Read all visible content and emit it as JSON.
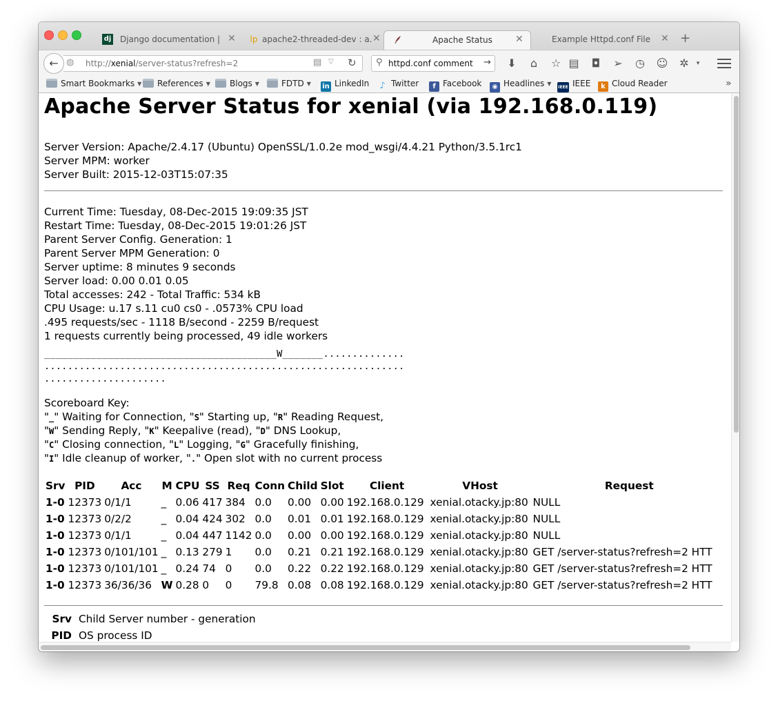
{
  "browser": {
    "tabs": [
      {
        "label": "Django documentation | ...",
        "icon": "dj",
        "active": false
      },
      {
        "label": "apache2-threaded-dev : a...",
        "icon": "lp",
        "active": false
      },
      {
        "label": "Apache Status",
        "icon": "apache-feather-icon",
        "active": true
      },
      {
        "label": "Example Httpd.conf File",
        "icon": "",
        "active": false
      }
    ],
    "url": {
      "prefix": "http://",
      "host": "xenial",
      "path": "/server-status?refresh=2"
    },
    "search": {
      "value": "httpd.conf comment"
    },
    "bookmarks": [
      {
        "label": "Smart Bookmarks",
        "type": "folder"
      },
      {
        "label": "References",
        "type": "folder"
      },
      {
        "label": "Blogs",
        "type": "folder"
      },
      {
        "label": "FDTD",
        "type": "folder"
      },
      {
        "label": "LinkedIn",
        "type": "link",
        "badge": "in",
        "color": "#0e76a8"
      },
      {
        "label": "Twitter",
        "type": "link",
        "color": "#55acee"
      },
      {
        "label": "Facebook",
        "type": "link",
        "badge": "f",
        "color": "#3b5998"
      },
      {
        "label": "Headlines",
        "type": "folder-feed",
        "color": "#3a5ba0"
      },
      {
        "label": "IEEE",
        "type": "link",
        "badge": "IEEE",
        "color": "#00285a"
      },
      {
        "label": "Cloud Reader",
        "type": "link",
        "badge": "k",
        "color": "#e07a10"
      }
    ]
  },
  "page": {
    "title": "Apache Server Status for xenial (via 192.168.0.119)",
    "server_info": [
      "Server Version: Apache/2.4.17 (Ubuntu) OpenSSL/1.0.2e mod_wsgi/4.4.21 Python/3.5.1rc1",
      "Server MPM: worker",
      "Server Built: 2015-12-03T15:07:35"
    ],
    "status_info": [
      "Current Time: Tuesday, 08-Dec-2015 19:09:35 JST",
      "Restart Time: Tuesday, 08-Dec-2015 19:01:26 JST",
      "Parent Server Config. Generation: 1",
      "Parent Server MPM Generation: 0",
      "Server uptime: 8 minutes 9 seconds",
      "Server load: 0.00 0.01 0.05",
      "Total accesses: 242 - Total Traffic: 534 kB",
      "CPU Usage: u.17 s.11 cu0 cs0 - .0573% CPU load",
      ".495 requests/sec - 1118 B/second - 2259 B/request",
      "1 requests currently being processed, 49 idle workers"
    ],
    "scoreboard": [
      "________________________________________W_______..............",
      "..............................................................",
      "....................."
    ],
    "scoreboard_key": {
      "title": "Scoreboard Key:",
      "lines": [
        [
          {
            "t": "\""
          },
          {
            "b": "_"
          },
          {
            "t": "\" Waiting for Connection, \""
          },
          {
            "b": "S"
          },
          {
            "t": "\" Starting up, \""
          },
          {
            "b": "R"
          },
          {
            "t": "\" Reading Request,"
          }
        ],
        [
          {
            "t": "\""
          },
          {
            "b": "W"
          },
          {
            "t": "\" Sending Reply, \""
          },
          {
            "b": "K"
          },
          {
            "t": "\" Keepalive (read), \""
          },
          {
            "b": "D"
          },
          {
            "t": "\" DNS Lookup,"
          }
        ],
        [
          {
            "t": "\""
          },
          {
            "b": "C"
          },
          {
            "t": "\" Closing connection, \""
          },
          {
            "b": "L"
          },
          {
            "t": "\" Logging, \""
          },
          {
            "b": "G"
          },
          {
            "t": "\" Gracefully finishing,"
          }
        ],
        [
          {
            "t": "\""
          },
          {
            "b": "I"
          },
          {
            "t": "\" Idle cleanup of worker, \""
          },
          {
            "b": "."
          },
          {
            "t": "\" Open slot with no current process"
          }
        ]
      ]
    },
    "table": {
      "headers": [
        "Srv",
        "PID",
        "Acc",
        "M",
        "CPU",
        "SS",
        "Req",
        "Conn",
        "Child",
        "Slot",
        "Client",
        "VHost",
        "Request"
      ],
      "rows": [
        [
          "1-0",
          "12373",
          "0/1/1",
          "_",
          "0.06",
          "417",
          "384",
          "0.0",
          "0.00",
          "0.00",
          "192.168.0.129",
          "xenial.otacky.jp:80",
          "NULL"
        ],
        [
          "1-0",
          "12373",
          "0/2/2",
          "_",
          "0.04",
          "424",
          "302",
          "0.0",
          "0.01",
          "0.01",
          "192.168.0.129",
          "xenial.otacky.jp:80",
          "NULL"
        ],
        [
          "1-0",
          "12373",
          "0/1/1",
          "_",
          "0.04",
          "447",
          "1142",
          "0.0",
          "0.00",
          "0.00",
          "192.168.0.129",
          "xenial.otacky.jp:80",
          "NULL"
        ],
        [
          "1-0",
          "12373",
          "0/101/101",
          "_",
          "0.13",
          "279",
          "1",
          "0.0",
          "0.21",
          "0.21",
          "192.168.0.129",
          "xenial.otacky.jp:80",
          "GET /server-status?refresh=2 HTT"
        ],
        [
          "1-0",
          "12373",
          "0/101/101",
          "_",
          "0.24",
          "74",
          "0",
          "0.0",
          "0.22",
          "0.22",
          "192.168.0.129",
          "xenial.otacky.jp:80",
          "GET /server-status?refresh=2 HTT"
        ],
        [
          "1-0",
          "12373",
          "36/36/36",
          "W",
          "0.28",
          "0",
          "0",
          "79.8",
          "0.08",
          "0.08",
          "192.168.0.129",
          "xenial.otacky.jp:80",
          "GET /server-status?refresh=2 HTT"
        ]
      ]
    },
    "legend": [
      {
        "key": "Srv",
        "desc": "Child Server number - generation"
      },
      {
        "key": "PID",
        "desc": "OS process ID"
      }
    ]
  }
}
